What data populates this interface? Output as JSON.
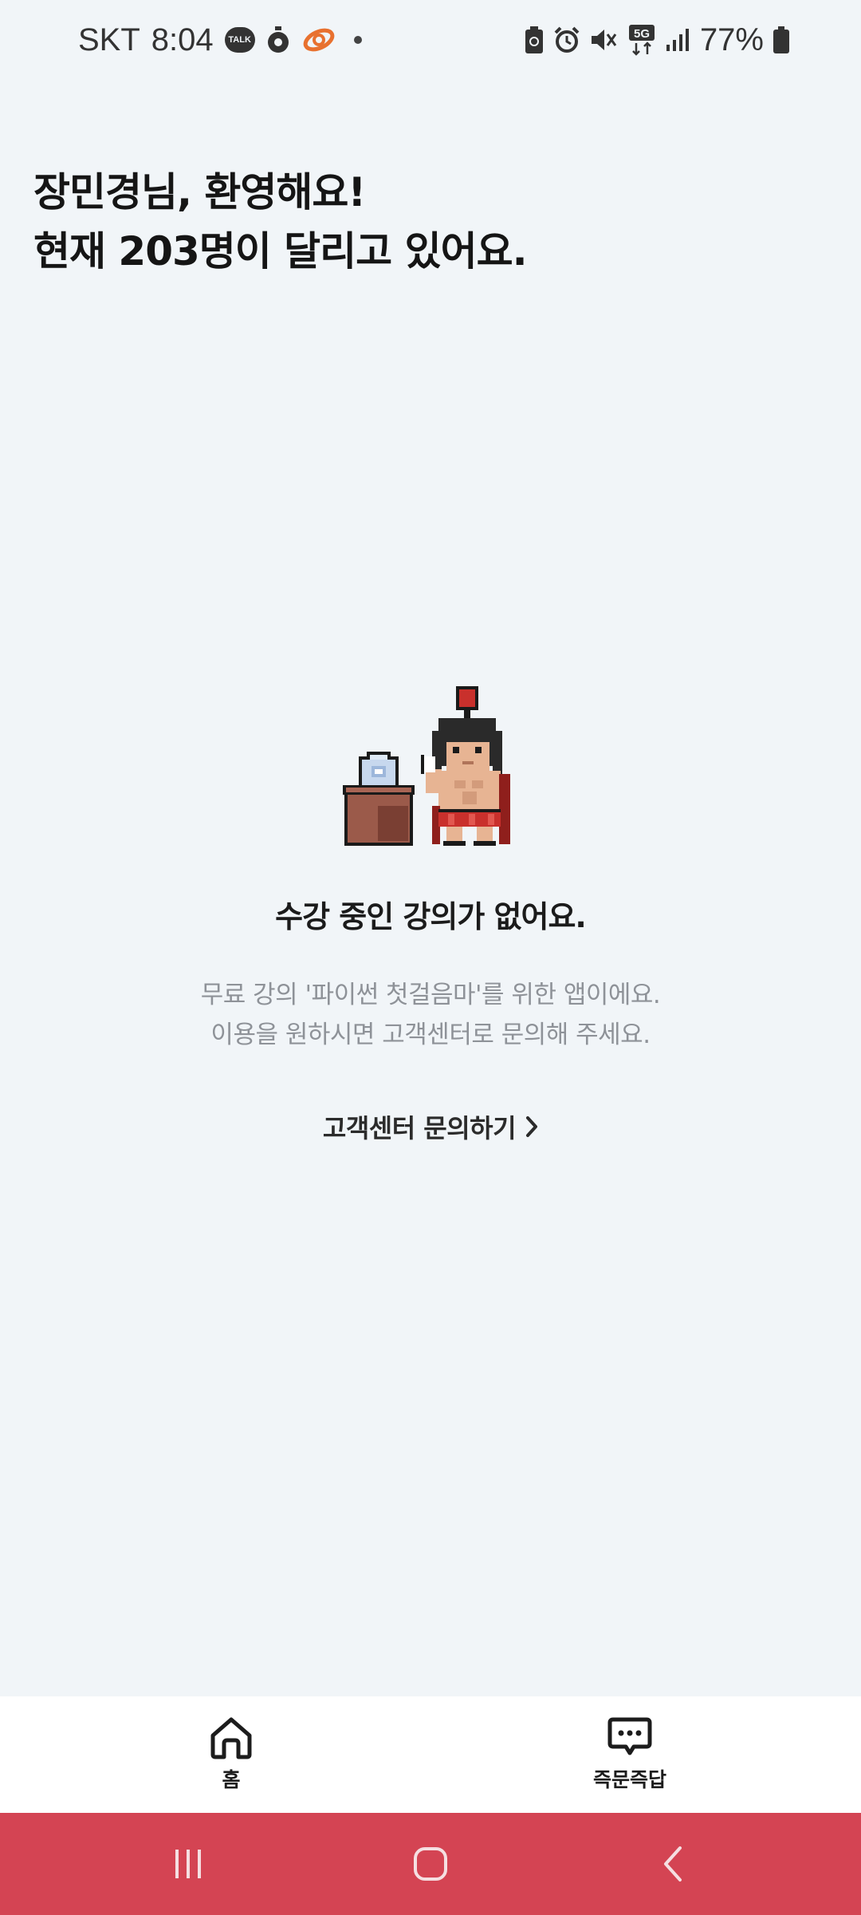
{
  "status_bar": {
    "carrier": "SKT",
    "time": "8:04",
    "talk_badge": "TALK",
    "network": "5G",
    "battery": "77%"
  },
  "greeting": {
    "line1": "장민경님, 환영해요!",
    "line2": "현재 203명이 달리고 있어요."
  },
  "empty_state": {
    "title": "수강 중인 강의가 없어요.",
    "desc_line1": "무료 강의 '파이썬 첫걸음마'를 위한 앱이에요.",
    "desc_line2": "이용을 원하시면 고객센터로 문의해 주세요.",
    "cs_link": "고객센터 문의하기"
  },
  "tabs": [
    {
      "label": "홈",
      "icon": "home-icon"
    },
    {
      "label": "즉문즉답",
      "icon": "chat-icon"
    }
  ],
  "nav": {
    "recents": "recents-icon",
    "home": "home-circle-icon",
    "back": "back-icon"
  },
  "colors": {
    "background": "#f1f5f8",
    "nav_bar": "#d44453",
    "tab_bar": "#ffffff"
  }
}
